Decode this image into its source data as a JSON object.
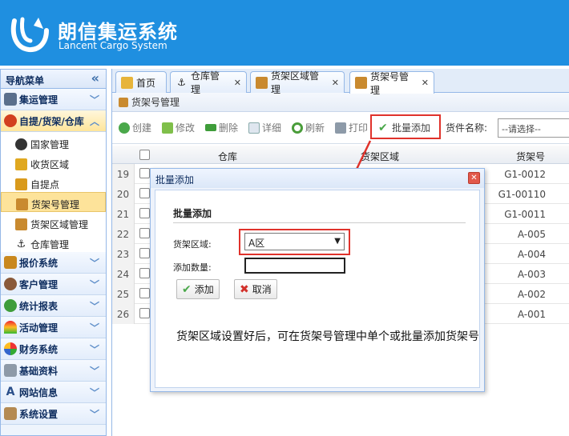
{
  "brand": {
    "title_cn": "朗信集运系统",
    "title_en": "Lancent Cargo System"
  },
  "sidebar": {
    "header": "导航菜单",
    "collapse_glyph": "«",
    "groups": [
      {
        "label": "集运管理"
      },
      {
        "label": "自提/货架/仓库"
      },
      {
        "label": "报价系统"
      },
      {
        "label": "客户管理"
      },
      {
        "label": "统计报表"
      },
      {
        "label": "活动管理"
      },
      {
        "label": "财务系统"
      },
      {
        "label": "基础资料"
      },
      {
        "label": "网站信息"
      },
      {
        "label": "系统设置"
      }
    ],
    "sub_items": [
      {
        "label": "国家管理"
      },
      {
        "label": "收货区域"
      },
      {
        "label": "自提点"
      },
      {
        "label": "货架号管理"
      },
      {
        "label": "货架区域管理"
      },
      {
        "label": "仓库管理"
      }
    ]
  },
  "tabs": [
    {
      "label": "首页"
    },
    {
      "label": "仓库管理"
    },
    {
      "label": "货架区域管理"
    },
    {
      "label": "货架号管理"
    }
  ],
  "page_title": "货架号管理",
  "toolbar": {
    "create": "创建",
    "edit": "修改",
    "delete": "删除",
    "detail": "详细",
    "refresh": "刷新",
    "print": "打印",
    "batch_add": "批量添加",
    "item_name_label": "货件名称:",
    "select_placeholder": "--请选择--"
  },
  "table": {
    "columns": [
      "仓库",
      "货架区域",
      "货架号"
    ],
    "rows": [
      {
        "n": "19",
        "code": "G1-0012"
      },
      {
        "n": "20",
        "code": "G1-00110"
      },
      {
        "n": "21",
        "code": "G1-0011"
      },
      {
        "n": "22",
        "code": "A-005"
      },
      {
        "n": "23",
        "code": "A-004"
      },
      {
        "n": "24",
        "code": "A-003"
      },
      {
        "n": "25",
        "code": "A-002"
      },
      {
        "n": "26",
        "code": "A-001"
      }
    ]
  },
  "dialog": {
    "title": "批量添加",
    "form_title": "批量添加",
    "area_label": "货架区域:",
    "area_value": "A区",
    "qty_label": "添加数量:",
    "qty_value": "",
    "add_button": "添加",
    "cancel_button": "取消",
    "close_glyph": "✕",
    "note": "货架区域设置好后，可在货架号管理中单个或批量添加货架号"
  },
  "colors": {
    "header_bg": "#1f8fe0",
    "highlight": "#e0322b",
    "selected_item": "#fde39a"
  }
}
